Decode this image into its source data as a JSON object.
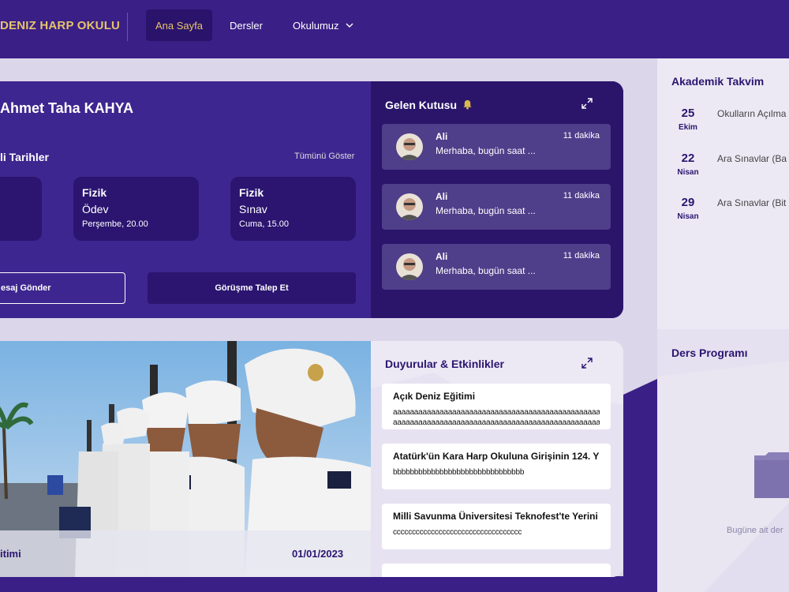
{
  "nav": {
    "brand": "DENIZ HARP OKULU",
    "items": [
      {
        "label": "Ana Sayfa",
        "active": true
      },
      {
        "label": "Dersler",
        "active": false
      },
      {
        "label": "Okulumuz",
        "active": false,
        "has_dropdown": true
      }
    ]
  },
  "profile": {
    "name": "Ahmet Taha KAHYA"
  },
  "due_dates": {
    "title": "li Tarihler",
    "show_all": "Tümünü Göster",
    "cards": [
      {
        "subject": "",
        "type": "",
        "when": ""
      },
      {
        "subject": "Fizik",
        "type": "Ödev",
        "when": "Perşembe, 20.00"
      },
      {
        "subject": "Fizik",
        "type": "Sınav",
        "when": "Cuma, 15.00"
      }
    ]
  },
  "actions": {
    "send_message": "esaj Gönder",
    "request_meeting": "Görüşme Talep Et"
  },
  "inbox": {
    "title": "Gelen Kutusu",
    "messages": [
      {
        "from": "Ali",
        "time": "11 dakika",
        "text": "Merhaba, bugün saat ..."
      },
      {
        "from": "Ali",
        "time": "11 dakika",
        "text": "Merhaba, bugün saat ..."
      },
      {
        "from": "Ali",
        "time": "11 dakika",
        "text": "Merhaba, bugün saat ..."
      }
    ]
  },
  "calendar": {
    "title": "Akademik Takvim",
    "events": [
      {
        "day": "25",
        "month": "Ekim",
        "event": "Okulların Açılma"
      },
      {
        "day": "22",
        "month": "Nisan",
        "event": "Ara Sınavlar (Ba"
      },
      {
        "day": "29",
        "month": "Nisan",
        "event": "Ara Sınavlar (Bit"
      }
    ]
  },
  "program": {
    "title": "Ders Programı",
    "empty_text": "Bugüne ait der"
  },
  "featured": {
    "title": "itimi",
    "date": "01/01/2023"
  },
  "news": {
    "title": "Duyurular & Etkinlikler",
    "items": [
      {
        "title": "Açık Deniz Eğitimi",
        "body": "aaaaaaaaaaaaaaaaaaaaaaaaaaaaaaaaaaaaaaaaaaaaaaaaaaa",
        "body2": "aaaaaaaaaaaaaaaaaaaaaaaaaaaaaaaaaaaaaaaaaaaaaaaaaaa"
      },
      {
        "title": "Atatürk'ün Kara Harp Okuluna Girişinin 124. Y",
        "body": "bbbbbbbbbbbbbbbbbbbbbbbbbbbbbbb"
      },
      {
        "title": "Milli Savunma Üniversitesi Teknofest'te Yerini",
        "body": "cccccccccccccccccccccccccccccccccc"
      }
    ]
  },
  "colors": {
    "primary": "#3a1f86",
    "dark": "#2b1570",
    "gold": "#e7c46b",
    "background": "#dcd6ea"
  }
}
